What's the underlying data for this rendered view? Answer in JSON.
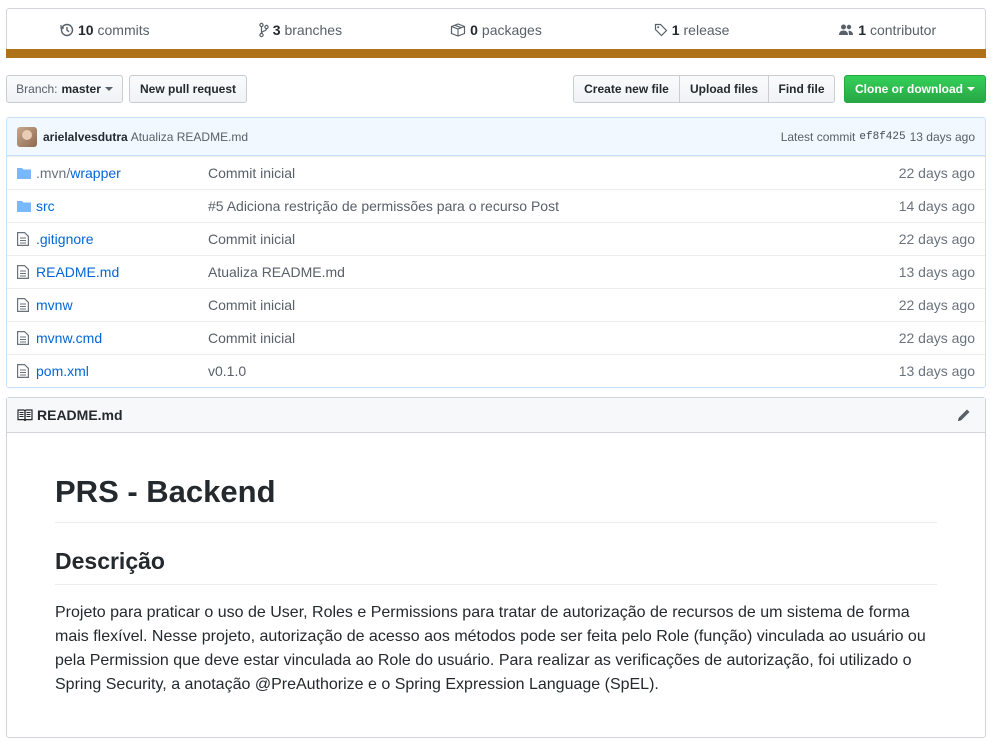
{
  "summary": {
    "commits": {
      "num": "10",
      "label": "commits",
      "icon": "history-icon"
    },
    "branches": {
      "num": "3",
      "label": "branches",
      "icon": "git-branch-icon"
    },
    "packages": {
      "num": "0",
      "label": "packages",
      "icon": "package-icon"
    },
    "releases": {
      "num": "1",
      "label": "release",
      "icon": "tag-icon"
    },
    "contributors": {
      "num": "1",
      "label": "contributor",
      "icon": "people-icon"
    },
    "language_color": "#b07219"
  },
  "toolbar": {
    "branch_prefix": "Branch:",
    "branch_name": "master",
    "new_pr": "New pull request",
    "create_file": "Create new file",
    "upload_files": "Upload files",
    "find_file": "Find file",
    "clone": "Clone or download",
    "clone_color": "#28a745"
  },
  "latest_commit": {
    "author": "arielalvesdutra",
    "message": "Atualiza README.md",
    "prefix": "Latest commit",
    "sha": "ef8f425",
    "age": "13 days ago"
  },
  "files": [
    {
      "type": "dir",
      "prefix": ".mvn/",
      "name": "wrapper",
      "message": "Commit inicial",
      "age": "22 days ago"
    },
    {
      "type": "dir",
      "prefix": "",
      "name": "src",
      "message": "#5 Adiciona restrição de permissões para o recurso Post",
      "age": "14 days ago"
    },
    {
      "type": "file",
      "prefix": "",
      "name": ".gitignore",
      "message": "Commit inicial",
      "age": "22 days ago"
    },
    {
      "type": "file",
      "prefix": "",
      "name": "README.md",
      "message": "Atualiza README.md",
      "age": "13 days ago"
    },
    {
      "type": "file",
      "prefix": "",
      "name": "mvnw",
      "message": "Commit inicial",
      "age": "22 days ago"
    },
    {
      "type": "file",
      "prefix": "",
      "name": "mvnw.cmd",
      "message": "Commit inicial",
      "age": "22 days ago"
    },
    {
      "type": "file",
      "prefix": "",
      "name": "pom.xml",
      "message": "v0.1.0",
      "age": "13 days ago"
    }
  ],
  "readme": {
    "filename": "README.md",
    "h1": "PRS - Backend",
    "h2": "Descrição",
    "paragraph": "Projeto para praticar o uso de User, Roles e Permissions para tratar de autorização de recursos de um sistema de forma mais flexível. Nesse projeto, autorização de acesso aos métodos pode ser feita pelo Role (função) vinculada ao usuário ou pela Permission que deve estar vinculada ao Role do usuário. Para realizar as verificações de autorização, foi utilizado o Spring Security, a anotação @PreAuthorize e o Spring Expression Language (SpEL)."
  }
}
